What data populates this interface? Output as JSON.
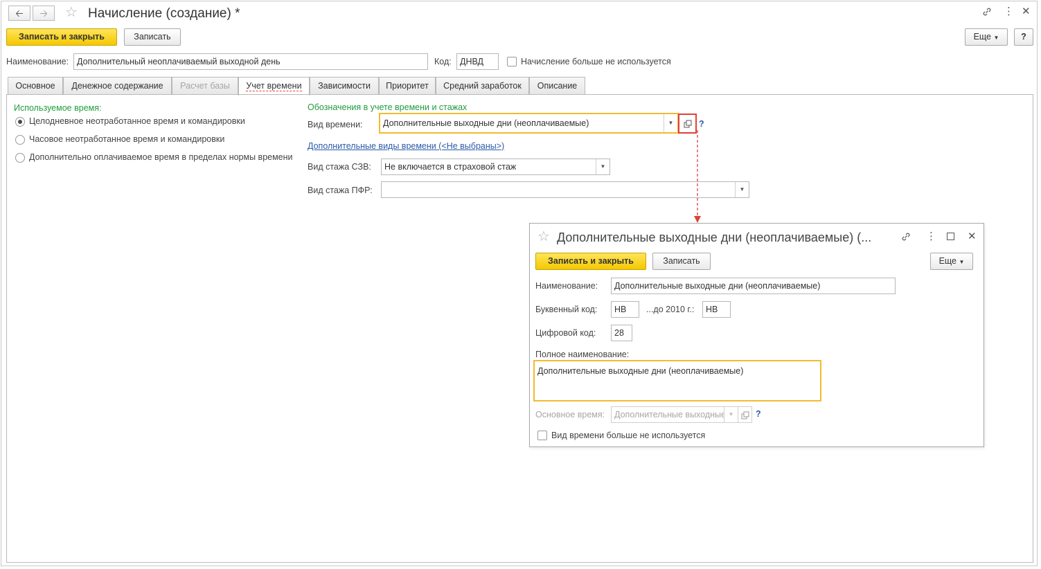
{
  "window": {
    "title": "Начисление (создание) *",
    "more_label": "Еще",
    "help_label": "?"
  },
  "toolbar": {
    "save_close_label": "Записать и закрыть",
    "save_label": "Записать"
  },
  "header": {
    "name_label": "Наименование:",
    "name_value": "Дополнительный неоплачиваемый выходной день",
    "code_label": "Код:",
    "code_value": "ДНВД",
    "unused_checkbox_label": "Начисление больше не используется",
    "unused_checked": false
  },
  "tabs": [
    {
      "label": "Основное"
    },
    {
      "label": "Денежное содержание"
    },
    {
      "label": "Расчет базы"
    },
    {
      "label": "Учет времени"
    },
    {
      "label": "Зависимости"
    },
    {
      "label": "Приоритет"
    },
    {
      "label": "Средний заработок"
    },
    {
      "label": "Описание"
    }
  ],
  "active_tab": "Учет времени",
  "left_panel": {
    "group_title": "Используемое время:",
    "options": [
      {
        "label": "Целодневное неотработанное время и командировки",
        "selected": true
      },
      {
        "label": "Часовое неотработанное время и командировки",
        "selected": false
      },
      {
        "label": "Дополнительно оплачиваемое время в пределах нормы времени",
        "selected": false
      }
    ]
  },
  "right_panel": {
    "group_title": "Обозначения в учете времени и стажах",
    "time_type_label": "Вид времени:",
    "time_type_value": "Дополнительные выходные дни (неоплачиваемые)",
    "help_label": "?",
    "additional_link": "Дополнительные виды времени (<Не выбраны>)",
    "szv_label": "Вид стажа СЗВ:",
    "szv_value": "Не включается в страховой стаж",
    "pfr_label": "Вид стажа ПФР:",
    "pfr_value": ""
  },
  "subwindow": {
    "title": "Дополнительные выходные дни (неоплачиваемые) (...",
    "save_close_label": "Записать и закрыть",
    "save_label": "Записать",
    "more_label": "Еще",
    "name_label": "Наименование:",
    "name_value": "Дополнительные выходные дни (неоплачиваемые)",
    "letter_code_label": "Буквенный код:",
    "letter_code_value": "НВ",
    "before2010_label": "...до 2010 г.:",
    "before2010_value": "НВ",
    "digit_code_label": "Цифровой код:",
    "digit_code_value": "28",
    "full_name_label": "Полное наименование:",
    "full_name_value": "Дополнительные выходные дни (неоплачиваемые)",
    "main_time_label": "Основное время:",
    "main_time_value": "Дополнительные выходные",
    "help_label": "?",
    "unused_checkbox_label": "Вид времени больше не используется",
    "unused_checked": false
  },
  "colors": {
    "primary_button": "#f4c800",
    "focus_border": "#f2bb2f",
    "group_title": "#1f9c3c",
    "link": "#2a5aa8",
    "highlight_box": "#e0403a"
  }
}
